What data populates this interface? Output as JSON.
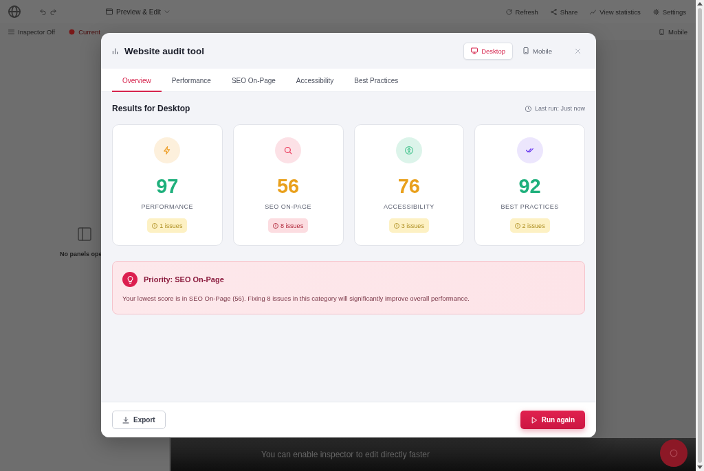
{
  "app": {
    "topbar": {
      "mode": "Preview & Edit",
      "actions": [
        {
          "kind": "refresh",
          "label": "Refresh"
        },
        {
          "kind": "share",
          "label": "Share"
        },
        {
          "kind": "statistics",
          "label": "View statistics"
        },
        {
          "kind": "settings",
          "label": "Settings"
        }
      ]
    },
    "toolbar": {
      "left": [
        {
          "kind": "inspector",
          "label": "Inspector Off"
        },
        {
          "kind": "record",
          "label": "Current"
        }
      ],
      "right": [
        {
          "kind": "mobile",
          "label": "Mobile"
        }
      ]
    },
    "side_panel": {
      "title": "No panels ope"
    },
    "notification": {
      "text": "You can enable inspector to edit directly faster"
    }
  },
  "dialog": {
    "title": "Website audit tool",
    "devices": [
      {
        "kind": "desktop",
        "label": "Desktop",
        "selected": true
      },
      {
        "kind": "mobile",
        "label": "Mobile",
        "selected": false
      }
    ],
    "tabs": [
      {
        "label": "Overview",
        "selected": true
      },
      {
        "label": "Performance",
        "selected": false
      },
      {
        "label": "SEO On-Page",
        "selected": false
      },
      {
        "label": "Accessibility",
        "selected": false
      },
      {
        "label": "Best Practices",
        "selected": false
      }
    ],
    "results_title": "Results for Desktop",
    "last_run": "Last run: Just now",
    "cards": [
      {
        "icon": {
          "kind": "performance",
          "color": "#fdf0dc"
        },
        "score": {
          "value": "97",
          "color": "#1fb07c"
        },
        "label": "PERFORMANCE",
        "issues": {
          "text": "1 issues",
          "color": "#fdf1c4"
        }
      },
      {
        "icon": {
          "kind": "seo",
          "color": "#fce1e6"
        },
        "score": {
          "value": "56",
          "color": "#e9a01c"
        },
        "label": "SEO ON-PAGE",
        "issues": {
          "text": "8 issues",
          "color": "#fcdde1"
        }
      },
      {
        "icon": {
          "kind": "accessibility",
          "color": "#dcf4ea"
        },
        "score": {
          "value": "76",
          "color": "#e9a01c"
        },
        "label": "ACCESSIBILITY",
        "issues": {
          "text": "3 issues",
          "color": "#fdf1c4"
        }
      },
      {
        "icon": {
          "kind": "best_practices",
          "color": "#ece6fd"
        },
        "score": {
          "value": "92",
          "color": "#1fb07c"
        },
        "label": "BEST PRACTICES",
        "issues": {
          "text": "2 issues",
          "color": "#fdf1c4"
        }
      }
    ],
    "priority": {
      "title": "Priority: SEO On-Page",
      "text": "Your lowest score is in SEO On-Page (56). Fixing 8 issues in this category will significantly improve overall performance."
    },
    "buttons": [
      {
        "kind": "export",
        "label": "Export"
      },
      {
        "kind": "run",
        "label": "Run again"
      }
    ]
  }
}
